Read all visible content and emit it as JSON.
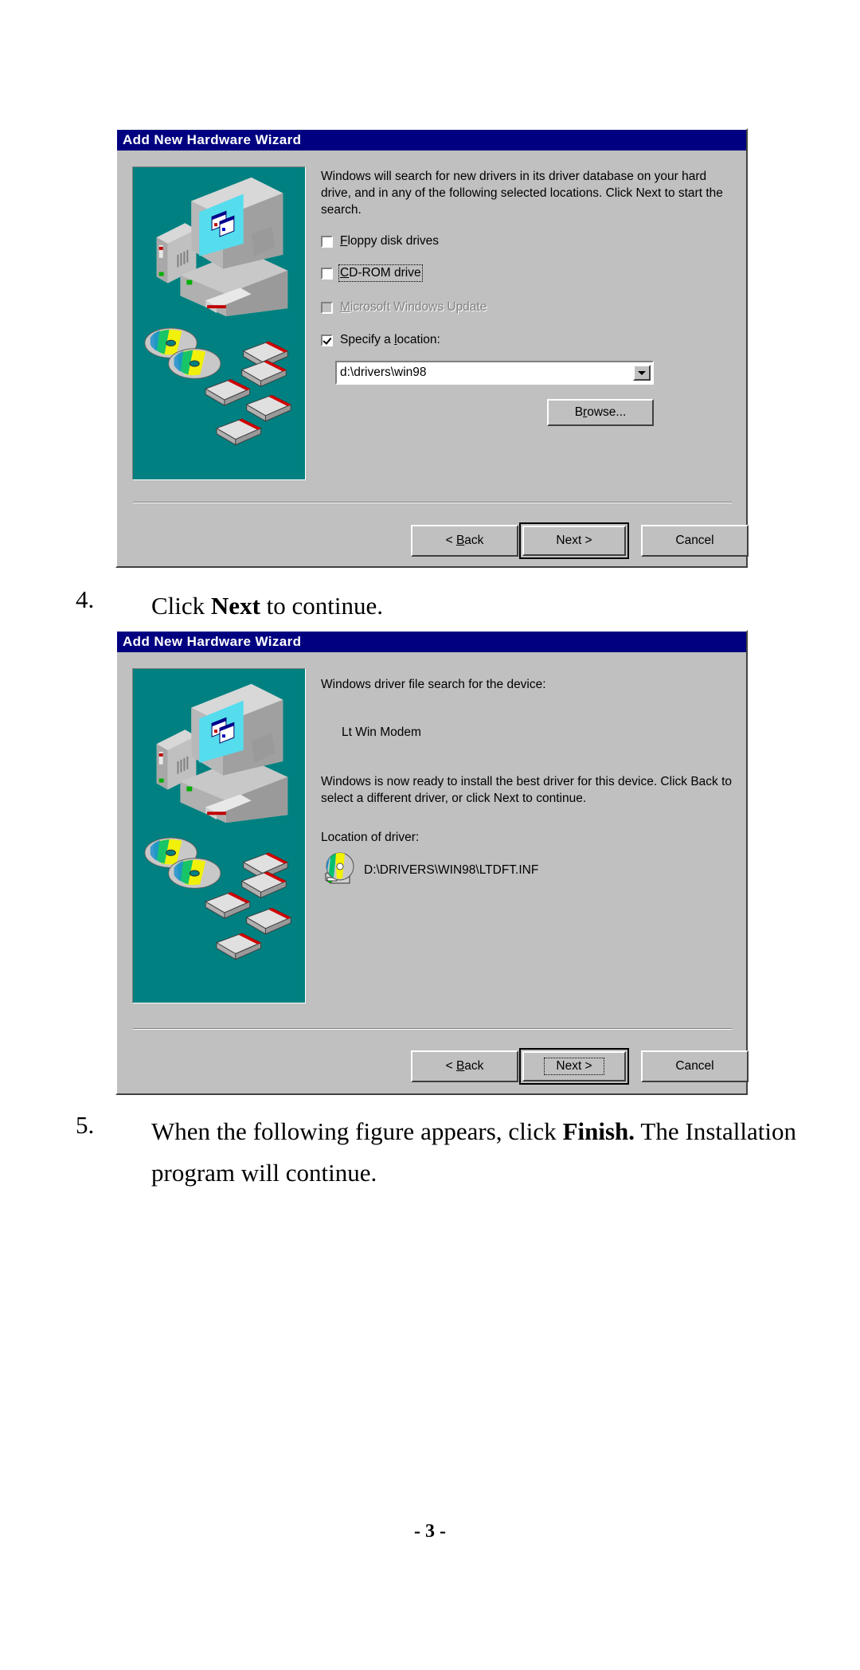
{
  "page": {
    "page_number": "- 3 -"
  },
  "dialog1": {
    "title": "Add New Hardware Wizard",
    "body_text": "Windows will search for new drivers in its driver database on your hard drive, and in any of the following selected locations. Click Next to start the search.",
    "checkboxes": [
      {
        "label": "Floppy disk drives",
        "accel": "F",
        "checked": false,
        "disabled": false,
        "focused": false
      },
      {
        "label": "CD-ROM drive",
        "accel": "C",
        "checked": false,
        "disabled": false,
        "focused": true
      },
      {
        "label": "Microsoft Windows Update",
        "accel": "M",
        "checked": false,
        "disabled": true,
        "focused": false
      },
      {
        "label": "Specify a location:",
        "accel": "l",
        "checked": true,
        "disabled": false,
        "focused": false
      }
    ],
    "location_combo": {
      "value": "d:\\drivers\\win98",
      "placeholder": "d:\\drivers\\win98"
    },
    "browse_button": "Browse...",
    "buttons": {
      "back": "< Back",
      "back_accel": "B",
      "next": "Next >",
      "cancel": "Cancel"
    }
  },
  "step4": {
    "number": "4.",
    "text_before": "Click ",
    "text_bold": "Next",
    "text_after": " to continue."
  },
  "dialog2": {
    "title": "Add New Hardware Wizard",
    "line1": "Windows driver file search for the device:",
    "device_name": "Lt Win Modem",
    "line2": "Windows is now ready to install the best driver for this device. Click Back to select a different driver, or click Next to continue.",
    "location_label": "Location of driver:",
    "driver_path": "D:\\DRIVERS\\WIN98\\LTDFT.INF",
    "driver_icon": "cdrom-drive-icon",
    "buttons": {
      "back": "< Back",
      "back_accel": "B",
      "next": "Next >",
      "cancel": "Cancel"
    }
  },
  "step5": {
    "number": "5.",
    "text_before": "When the following figure appears, click ",
    "text_bold": "Finish.",
    "text_after": " The Installation program will continue."
  },
  "colors": {
    "titlebar": "#000080",
    "dialog_face": "#c0c0c0",
    "illustration_bg": "#008080",
    "page_bg": "#ffffff"
  }
}
